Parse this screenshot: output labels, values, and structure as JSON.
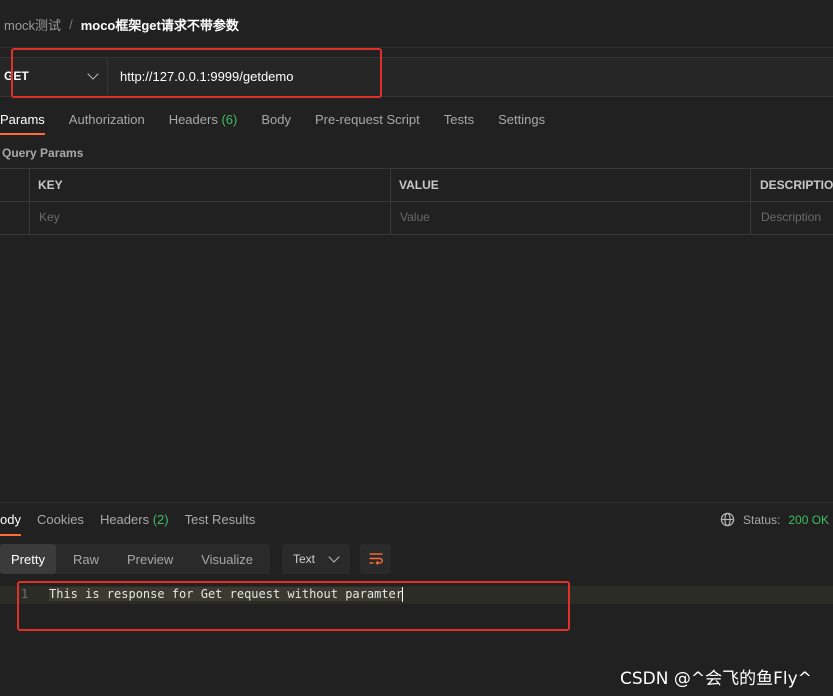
{
  "breadcrumb": {
    "collection": "mock测试",
    "separator": "/",
    "request": "moco框架get请求不带参数"
  },
  "request": {
    "method": "GET",
    "url": "http://127.0.0.1:9999/getdemo"
  },
  "request_tabs": [
    {
      "label": "Params"
    },
    {
      "label": "Authorization"
    },
    {
      "label": "Headers",
      "count": "(6)"
    },
    {
      "label": "Body"
    },
    {
      "label": "Pre-request Script"
    },
    {
      "label": "Tests"
    },
    {
      "label": "Settings"
    }
  ],
  "query_params": {
    "title": "Query Params",
    "headers": {
      "key": "KEY",
      "value": "VALUE",
      "description": "DESCRIPTION"
    },
    "placeholders": {
      "key": "Key",
      "value": "Value",
      "description": "Description"
    }
  },
  "response_tabs": [
    {
      "label": "ody"
    },
    {
      "label": "Cookies"
    },
    {
      "label": "Headers",
      "count": "(2)"
    },
    {
      "label": "Test Results"
    }
  ],
  "status": {
    "label": "Status:",
    "value": "200 OK"
  },
  "view_modes": [
    "Pretty",
    "Raw",
    "Preview",
    "Visualize"
  ],
  "format": "Text",
  "response_body": {
    "line_number": "1",
    "text": "This is response for Get request without paramter"
  },
  "watermark": "CSDN @^会飞的鱼Fly^",
  "colors": {
    "accent": "#ff6c37",
    "success": "#3fbd63",
    "highlight_box": "#e0302a",
    "background": "#212121"
  },
  "icons": [
    "chevron-down-icon",
    "globe-icon",
    "word-wrap-icon"
  ]
}
